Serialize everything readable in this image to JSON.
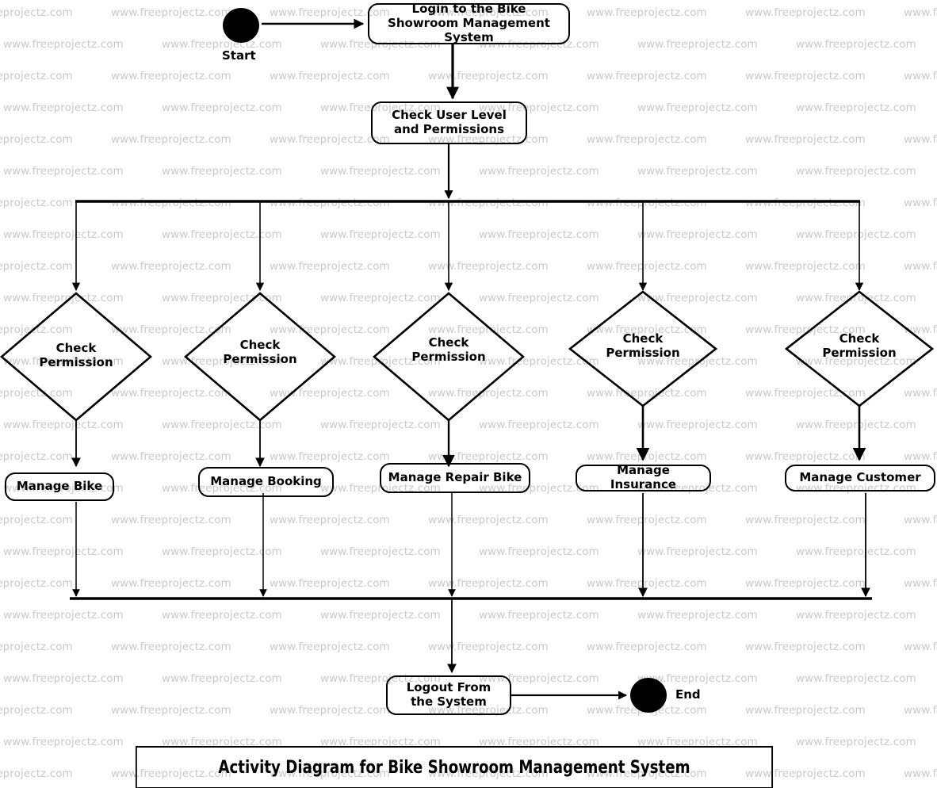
{
  "diagram": {
    "title": "Activity Diagram for Bike Showroom Management System",
    "type": "UML Activity Diagram",
    "watermark_text": "www.freeprojectz.com",
    "start_label": "Start",
    "end_label": "End",
    "nodes": {
      "login": "Login to the Bike Showroom Management System",
      "check_user": "Check User Level and Permissions",
      "logout": "Logout From the System"
    },
    "decisions": [
      {
        "id": "decision-1",
        "label": "Check\nPermission"
      },
      {
        "id": "decision-2",
        "label": "Check\nPermission"
      },
      {
        "id": "decision-3",
        "label": "Check\nPermission"
      },
      {
        "id": "decision-4",
        "label": "Check\nPermission"
      },
      {
        "id": "decision-5",
        "label": "Check\nPermission"
      }
    ],
    "activities": [
      {
        "id": "manage-bike",
        "label": "Manage Bike"
      },
      {
        "id": "manage-booking",
        "label": "Manage Booking"
      },
      {
        "id": "manage-repair-bike",
        "label": "Manage Repair Bike"
      },
      {
        "id": "manage-insurance",
        "label": "Manage Insurance"
      },
      {
        "id": "manage-customer",
        "label": "Manage Customer"
      }
    ],
    "colors": {
      "stroke": "#000000",
      "background": "#ffffff",
      "watermark": "#c9c9c9"
    }
  }
}
